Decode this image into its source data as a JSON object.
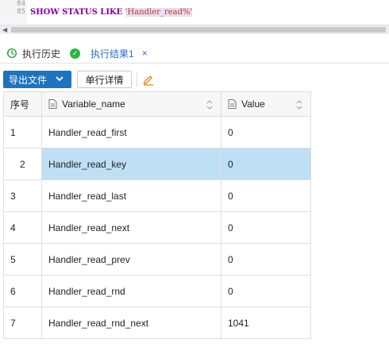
{
  "editor": {
    "lines": [
      {
        "number": "84",
        "text": ""
      },
      {
        "number": "85",
        "keyword": "SHOW STATUS LIKE ",
        "string": "'Handler_read%'"
      }
    ]
  },
  "tabs": {
    "history_label": "执行历史",
    "result_label": "执行结果1",
    "close_glyph": "×"
  },
  "toolbar": {
    "export_label": "导出文件",
    "detail_label": "单行详情"
  },
  "grid": {
    "columns": [
      "序号",
      "Variable_name",
      "Value"
    ],
    "rows": [
      {
        "num": "1",
        "name": "Handler_read_first",
        "value": "0"
      },
      {
        "num": "2",
        "name": "Handler_read_key",
        "value": "0"
      },
      {
        "num": "3",
        "name": "Handler_read_last",
        "value": "0"
      },
      {
        "num": "4",
        "name": "Handler_read_next",
        "value": "0"
      },
      {
        "num": "5",
        "name": "Handler_read_prev",
        "value": "0"
      },
      {
        "num": "6",
        "name": "Handler_read_rnd",
        "value": "0"
      },
      {
        "num": "7",
        "name": "Handler_read_rnd_next",
        "value": "1041"
      }
    ],
    "selected_row": 2
  },
  "colors": {
    "accent": "#1e73be",
    "selection": "#bfdff5",
    "keyword": "#7f0096",
    "string": "#c0332e",
    "ok_green": "#31b343"
  }
}
